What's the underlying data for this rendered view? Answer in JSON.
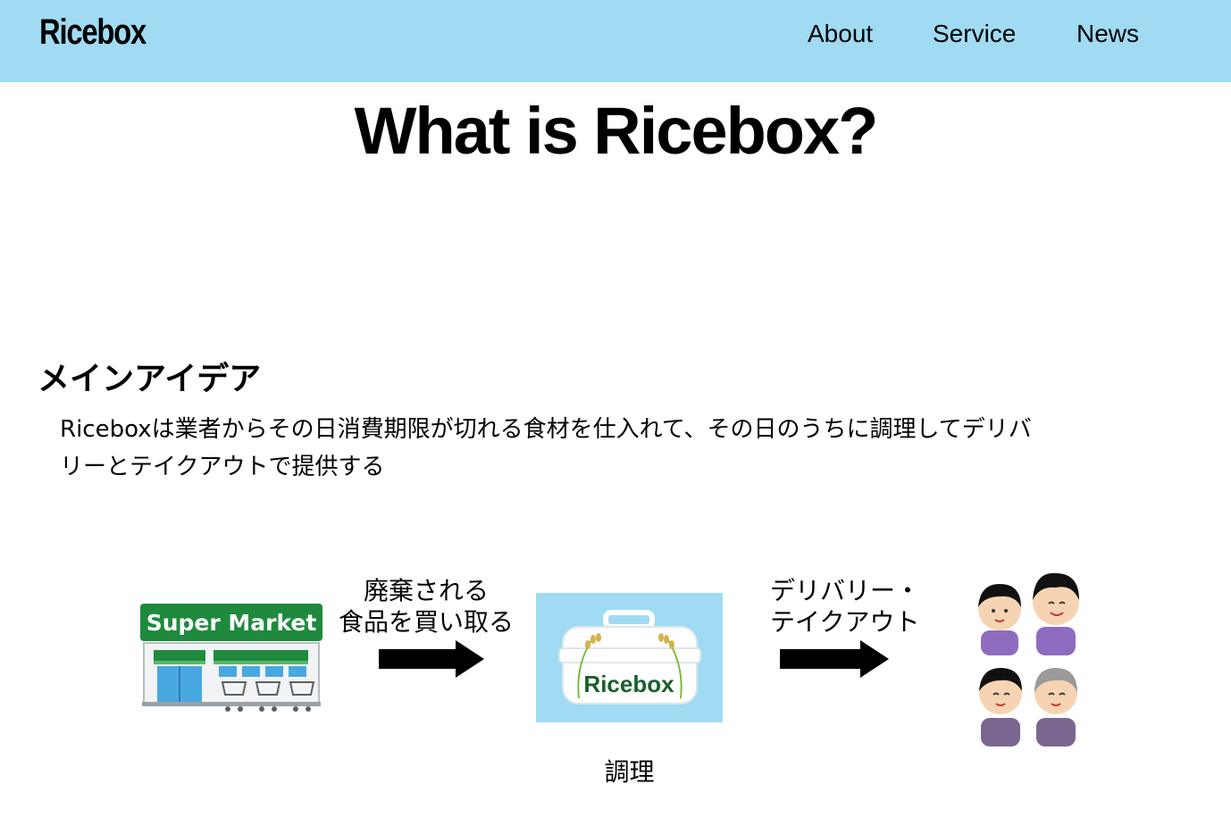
{
  "header": {
    "logo": "Ricebox",
    "nav": [
      {
        "label": "About"
      },
      {
        "label": "Service"
      },
      {
        "label": "News"
      }
    ]
  },
  "main": {
    "title": "What is Ricebox?",
    "section": {
      "heading": "メインアイデア",
      "body": "Riceboxは業者からその日消費期限が切れる食材を仕入れて、その日のうちに調理してデリバリーとテイクアウトで提供する"
    }
  },
  "illustration": {
    "market_sign": "Super Market",
    "step1_label_line1": "廃棄される",
    "step1_label_line2": "食品を買い取る",
    "box_label": "Ricebox",
    "cook_label": "調理",
    "step2_label_line1": "デリバリー・",
    "step2_label_line2": "テイクアウト"
  },
  "colors": {
    "header_bg": "#a0dbf3",
    "market_green": "#1f8a3e",
    "box_green_dark": "#1a5f2a",
    "box_green_light": "#2eaa3f"
  }
}
